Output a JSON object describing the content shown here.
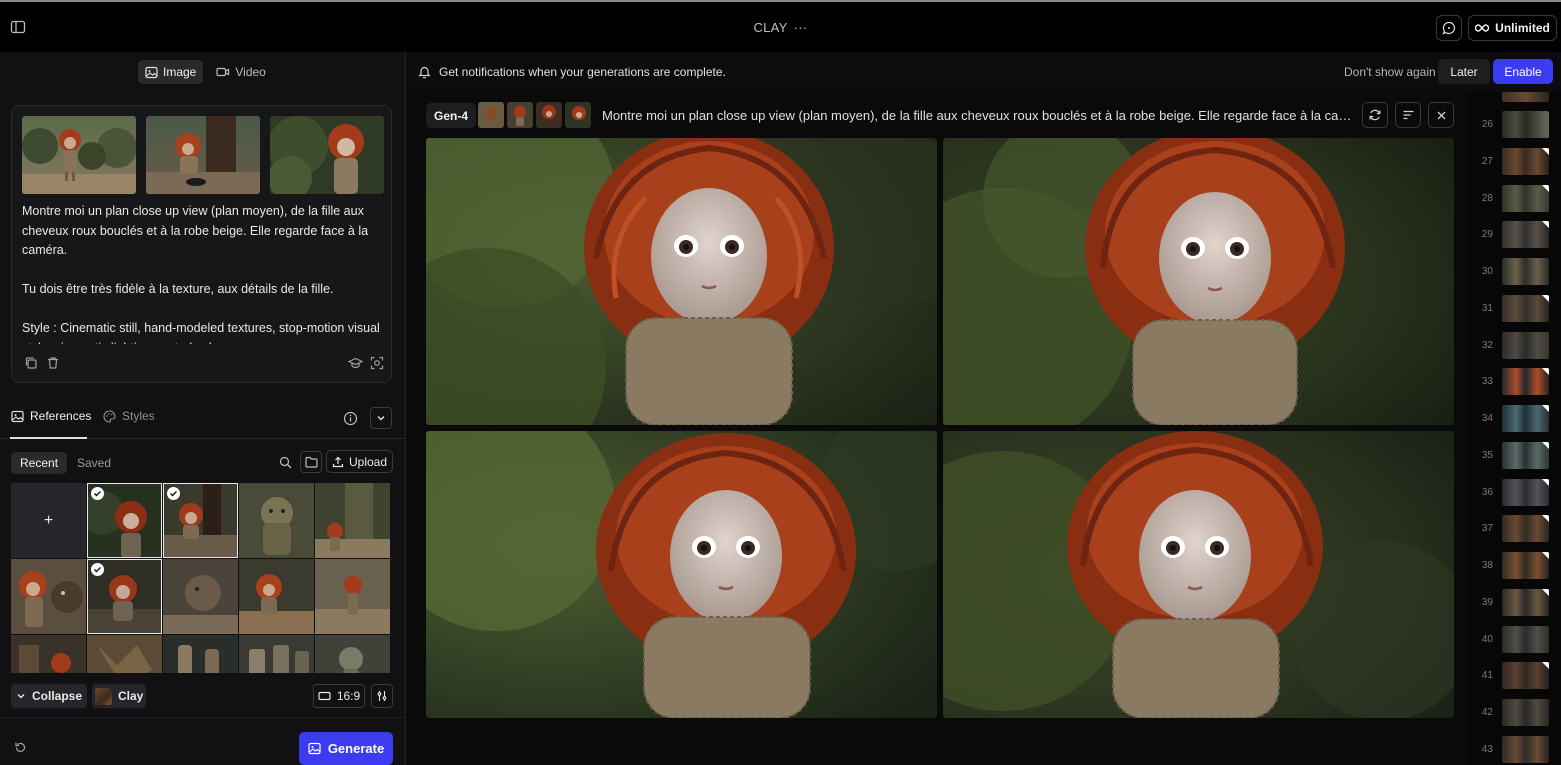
{
  "topbar": {
    "project_title": "CLAY",
    "more_glyph": "···",
    "plan_label": "Unlimited"
  },
  "left": {
    "mode_tabs": [
      {
        "label": "Image",
        "icon": "image-icon",
        "active": true
      },
      {
        "label": "Video",
        "icon": "video-icon",
        "active": false
      }
    ],
    "prompt": {
      "text": "Montre moi un plan close up view (plan moyen), de la fille aux cheveux roux bouclés et à la robe beige. Elle regarde face à la caméra.\n\nTu dois être très fidèle à la texture, aux détails de la fille.\n\nStyle : Cinematic still, hand-modeled textures, stop-motion visual style, cinematic lighting, muted color"
    },
    "ref_tabs": [
      {
        "label": "References",
        "icon": "references-icon",
        "active": true
      },
      {
        "label": "Styles",
        "icon": "palette-icon",
        "active": false
      }
    ],
    "filters": [
      {
        "label": "Recent",
        "active": true
      },
      {
        "label": "Saved",
        "active": false
      }
    ],
    "upload_label": "Upload",
    "add_glyph": "+",
    "collapse_label": "Collapse",
    "style_chip_label": "Clay",
    "aspect_ratio": "16:9",
    "generate_label": "Generate"
  },
  "notification": {
    "message": "Get notifications when your generations are complete.",
    "dismiss_label": "Don't show again",
    "later_label": "Later",
    "enable_label": "Enable"
  },
  "generation": {
    "model": "Gen-4",
    "prompt_preview": "Montre moi un plan close up view (plan moyen), de la fille aux cheveux roux bouclés et à la robe beige. Elle regarde face à la caméra."
  },
  "filmstrip": {
    "numbers": [
      "26",
      "27",
      "28",
      "29",
      "30",
      "31",
      "32",
      "33",
      "34",
      "35",
      "36",
      "37",
      "38",
      "39",
      "40",
      "41",
      "42",
      "43"
    ]
  },
  "colors": {
    "accent": "#3b3bf0",
    "background": "#0a0a0b",
    "panel": "#111113"
  }
}
